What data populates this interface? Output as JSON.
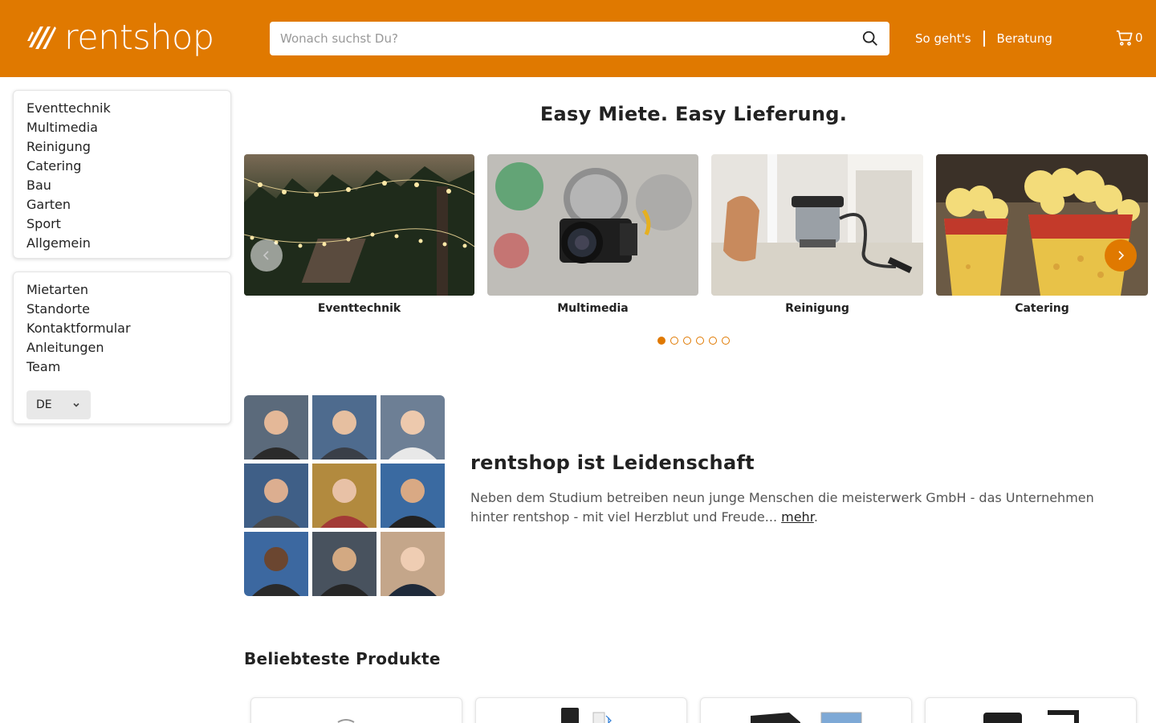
{
  "header": {
    "logo_text": "rentshop",
    "search_placeholder": "Wonach suchst Du?",
    "nav": [
      "So geht's",
      "Beratung"
    ],
    "cart_count": "0",
    "brand_color": "#e07900"
  },
  "sidebar": {
    "categories": [
      "Eventtechnik",
      "Multimedia",
      "Reinigung",
      "Catering",
      "Bau",
      "Garten",
      "Sport",
      "Allgemein"
    ],
    "links": [
      "Mietarten",
      "Standorte",
      "Kontaktformular",
      "Anleitungen",
      "Team"
    ],
    "language": "DE"
  },
  "hero": {
    "title": "Easy Miete. Easy Lieferung.",
    "slides": [
      {
        "label": "Eventtechnik",
        "icon": "string-lights-photo"
      },
      {
        "label": "Multimedia",
        "icon": "camera-photo"
      },
      {
        "label": "Reinigung",
        "icon": "vacuum-cleaner-photo"
      },
      {
        "label": "Catering",
        "icon": "popcorn-photo"
      }
    ],
    "dots": 6,
    "active_dot": 0
  },
  "about": {
    "title": "rentshop ist Leidenschaft",
    "text": "Neben dem Studium betreiben neun junge Menschen die meisterwerk GmbH - das Unternehmen hinter rentshop - mit viel Herzblut und Freude...",
    "more_link": "mehr",
    "after_link": "."
  },
  "products": {
    "title": "Beliebteste Produkte"
  }
}
